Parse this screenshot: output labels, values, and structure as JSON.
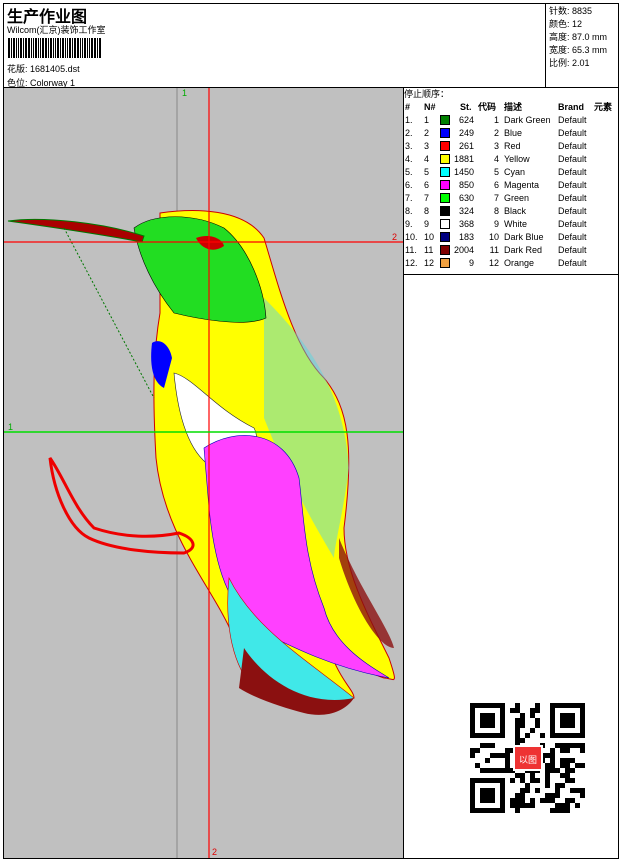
{
  "header": {
    "title": "生产作业图",
    "company": "Wilcom(汇京)装饰工作室",
    "design_label": "花版:",
    "design_file": "1681405.dst",
    "colorway_label": "色位:",
    "colorway": "Colorway 1"
  },
  "info": {
    "stitches": "针数: 8835",
    "colors": "颜色: 12",
    "height": "高度: 87.0 mm",
    "width": "宽度: 65.3 mm",
    "scale": "比例: 2.01"
  },
  "guides": {
    "v1": "1",
    "h2": "2",
    "h1": "1",
    "v2": "2"
  },
  "stop_sequence": {
    "title": "停止顺序：",
    "columns": [
      "#",
      "N#",
      "St.",
      "代码",
      "描述",
      "Brand",
      "元素"
    ],
    "rows": [
      {
        "idx": "1.",
        "n": "1",
        "color": "#008000",
        "st": "624",
        "code": "1",
        "desc": "Dark Green",
        "brand": "Default"
      },
      {
        "idx": "2.",
        "n": "2",
        "color": "#0000ff",
        "st": "249",
        "code": "2",
        "desc": "Blue",
        "brand": "Default"
      },
      {
        "idx": "3.",
        "n": "3",
        "color": "#ff0000",
        "st": "261",
        "code": "3",
        "desc": "Red",
        "brand": "Default"
      },
      {
        "idx": "4.",
        "n": "4",
        "color": "#ffff00",
        "st": "1881",
        "code": "4",
        "desc": "Yellow",
        "brand": "Default"
      },
      {
        "idx": "5.",
        "n": "5",
        "color": "#00ffff",
        "st": "1450",
        "code": "5",
        "desc": "Cyan",
        "brand": "Default"
      },
      {
        "idx": "6.",
        "n": "6",
        "color": "#ff00ff",
        "st": "850",
        "code": "6",
        "desc": "Magenta",
        "brand": "Default"
      },
      {
        "idx": "7.",
        "n": "7",
        "color": "#00ff00",
        "st": "630",
        "code": "7",
        "desc": "Green",
        "brand": "Default"
      },
      {
        "idx": "8.",
        "n": "8",
        "color": "#000000",
        "st": "324",
        "code": "8",
        "desc": "Black",
        "brand": "Default"
      },
      {
        "idx": "9.",
        "n": "9",
        "color": "#ffffff",
        "st": "368",
        "code": "9",
        "desc": "White",
        "brand": "Default"
      },
      {
        "idx": "10.",
        "n": "10",
        "color": "#000080",
        "st": "183",
        "code": "10",
        "desc": "Dark Blue",
        "brand": "Default"
      },
      {
        "idx": "11.",
        "n": "11",
        "color": "#800000",
        "st": "2004",
        "code": "11",
        "desc": "Dark Red",
        "brand": "Default"
      },
      {
        "idx": "12.",
        "n": "12",
        "color": "#f0a040",
        "st": "9",
        "code": "12",
        "desc": "Orange",
        "brand": "Default"
      }
    ]
  },
  "qr": {
    "stamp": "以图"
  }
}
